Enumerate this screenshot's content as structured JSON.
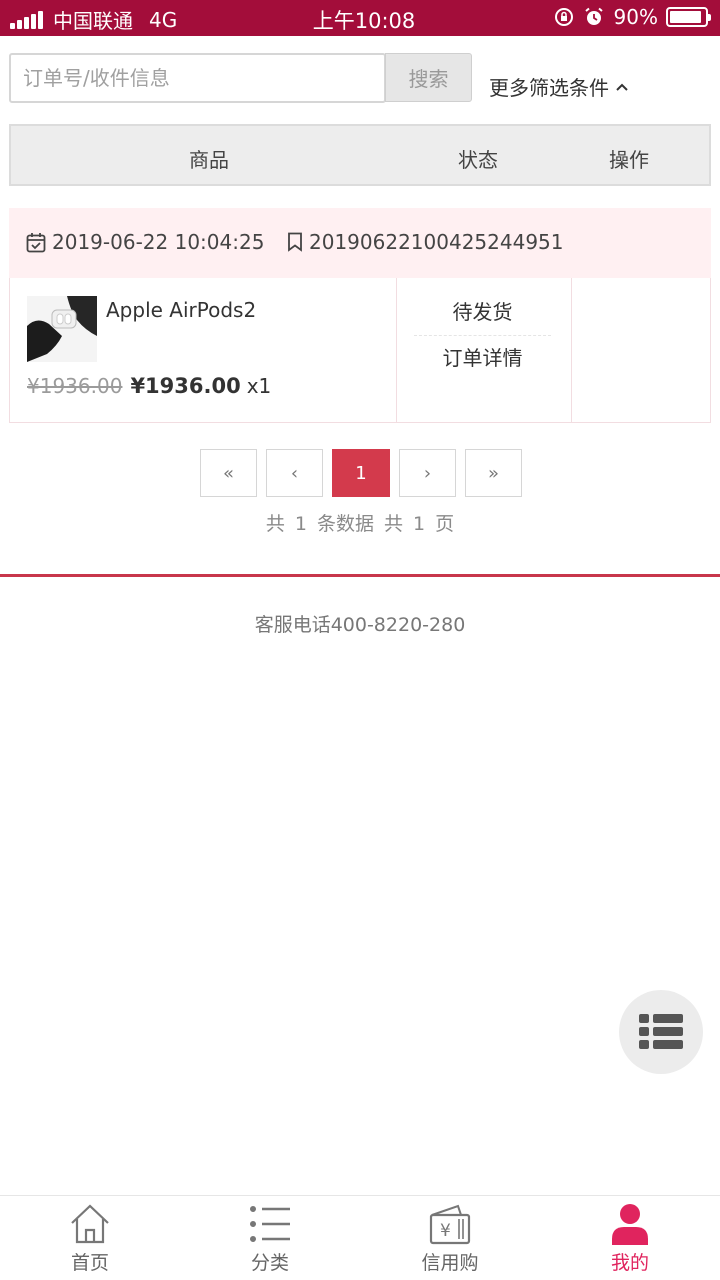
{
  "status_bar": {
    "carrier": "中国联通",
    "network": "4G",
    "time": "上午10:08",
    "battery": "90%"
  },
  "search": {
    "placeholder": "订单号/收件信息",
    "value": "",
    "button_label": "搜索",
    "filter_label": "更多筛选条件"
  },
  "table_header": {
    "product": "商品",
    "status": "状态",
    "action": "操作"
  },
  "orders": [
    {
      "date": "2019-06-22 10:04:25",
      "order_no": "20190622100425244951",
      "product_name": "Apple AirPods2",
      "price_original": "¥1936.00",
      "price_current": "¥1936.00",
      "quantity": "x1",
      "status": "待发货",
      "detail_link": "订单详情"
    }
  ],
  "pagination": {
    "first": "«",
    "prev": "‹",
    "current_page": "1",
    "next": "›",
    "last": "»",
    "summary": "共 1 条数据   共 1 页"
  },
  "footer": {
    "phone": "客服电话400-8220-280"
  },
  "tabbar": {
    "items": [
      {
        "label": "首页",
        "icon": "home-icon"
      },
      {
        "label": "分类",
        "icon": "category-list-icon"
      },
      {
        "label": "信用购",
        "icon": "credit-buy-icon"
      },
      {
        "label": "我的",
        "icon": "user-icon"
      }
    ],
    "active_color": "#e0245e"
  },
  "colors": {
    "status_bar": "#a30d3a",
    "accent": "#d33a4c",
    "order_header_bg": "#fff0f2"
  }
}
